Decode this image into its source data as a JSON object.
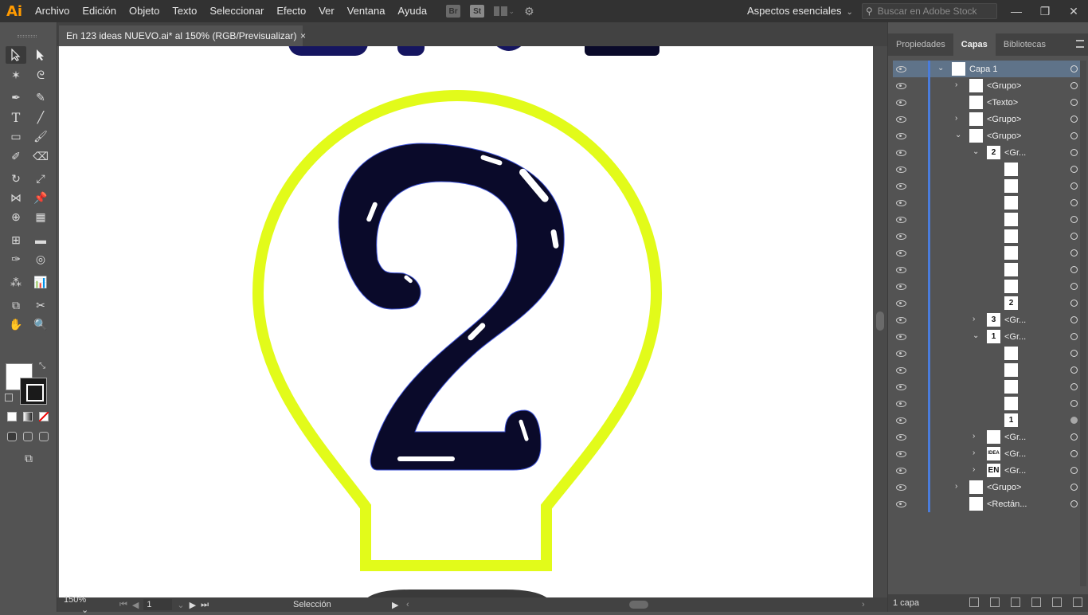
{
  "app": {
    "logo": "Ai",
    "menu": [
      "Archivo",
      "Edición",
      "Objeto",
      "Texto",
      "Seleccionar",
      "Efecto",
      "Ver",
      "Ventana",
      "Ayuda"
    ],
    "bridge_label": "Br",
    "stock_label": "St",
    "workspace": "Aspectos esenciales",
    "search_placeholder": "Buscar en Adobe Stock",
    "win": {
      "minimize": "—",
      "restore": "❐",
      "close": "✕"
    }
  },
  "document": {
    "tab_title": "En 123 ideas NUEVO.ai* al 150% (RGB/Previsualizar)",
    "close_label": "×"
  },
  "artwork": {
    "bulb_color": "#e2fb1a",
    "number_fill": "#0a0a2a",
    "number_glyph": "2",
    "top_shapes_color": "#1a1a66"
  },
  "status": {
    "zoom": "150%",
    "page": "1",
    "tool": "Selección"
  },
  "panel": {
    "tabs": [
      "Propiedades",
      "Capas",
      "Bibliotecas"
    ],
    "active_tab": "Capas",
    "footer": "1 capa",
    "layers": [
      {
        "name": "Capa 1",
        "thumb": "",
        "twisty": "open",
        "indent": 0,
        "selected": true
      },
      {
        "name": "<Grupo>",
        "thumb": "",
        "twisty": "closed",
        "indent": 1
      },
      {
        "name": "<Texto>",
        "thumb": "",
        "twisty": "",
        "indent": 1
      },
      {
        "name": "<Grupo>",
        "thumb": "",
        "twisty": "closed",
        "indent": 1
      },
      {
        "name": "<Grupo>",
        "thumb": "",
        "twisty": "open",
        "indent": 1
      },
      {
        "name": "<Gr...",
        "thumb": "2",
        "twisty": "open",
        "indent": 2
      },
      {
        "name": "",
        "thumb": "",
        "twisty": "",
        "indent": 3
      },
      {
        "name": "",
        "thumb": "",
        "twisty": "",
        "indent": 3
      },
      {
        "name": "",
        "thumb": "",
        "twisty": "",
        "indent": 3
      },
      {
        "name": "",
        "thumb": "",
        "twisty": "",
        "indent": 3
      },
      {
        "name": "",
        "thumb": "",
        "twisty": "",
        "indent": 3
      },
      {
        "name": "",
        "thumb": "",
        "twisty": "",
        "indent": 3
      },
      {
        "name": "",
        "thumb": "",
        "twisty": "",
        "indent": 3
      },
      {
        "name": "",
        "thumb": "",
        "twisty": "",
        "indent": 3
      },
      {
        "name": "",
        "thumb": "2",
        "twisty": "",
        "indent": 3
      },
      {
        "name": "<Gr...",
        "thumb": "3",
        "twisty": "closed",
        "indent": 2
      },
      {
        "name": "<Gr...",
        "thumb": "1",
        "twisty": "open",
        "indent": 2
      },
      {
        "name": "",
        "thumb": "",
        "twisty": "",
        "indent": 3
      },
      {
        "name": "",
        "thumb": "",
        "twisty": "",
        "indent": 3
      },
      {
        "name": "",
        "thumb": "",
        "twisty": "",
        "indent": 3
      },
      {
        "name": "",
        "thumb": "",
        "twisty": "",
        "indent": 3
      },
      {
        "name": "",
        "thumb": "1",
        "twisty": "",
        "indent": 3,
        "target_filled": true
      },
      {
        "name": "<Gr...",
        "thumb": "",
        "twisty": "closed",
        "indent": 2
      },
      {
        "name": "<Gr...",
        "thumb": "IDEA",
        "twisty": "closed",
        "indent": 2
      },
      {
        "name": "<Gr...",
        "thumb": "EN",
        "twisty": "closed",
        "indent": 2
      },
      {
        "name": "<Grupo>",
        "thumb": "",
        "twisty": "closed",
        "indent": 1
      },
      {
        "name": "<Rectán...",
        "thumb": "",
        "twisty": "",
        "indent": 1
      }
    ]
  }
}
